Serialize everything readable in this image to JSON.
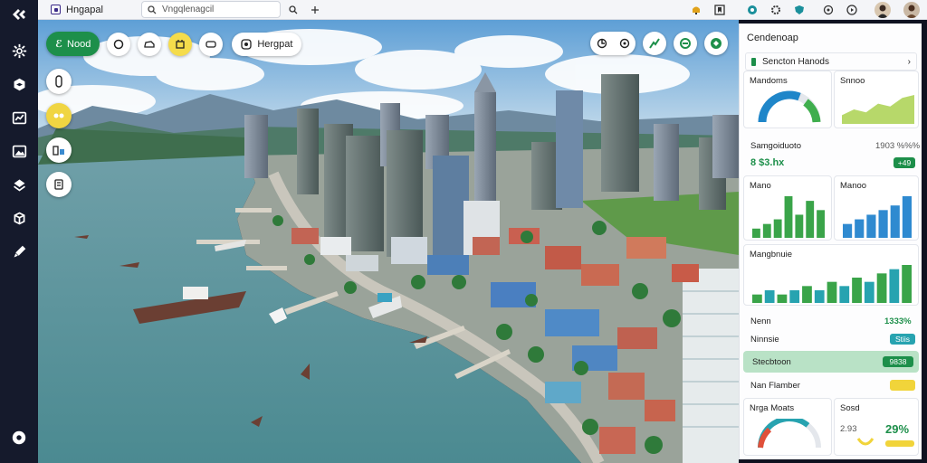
{
  "topbar": {
    "app_name": "Hngapal",
    "search_placeholder": "Vngqlenagcil",
    "icons": [
      "bell-icon",
      "bookmark-icon",
      "globe-icon",
      "settings-icon",
      "shield-icon",
      "gear-icon",
      "play-icon"
    ]
  },
  "viewport": {
    "primary_button": "Nood",
    "primary_button_icon": "ℰ",
    "location_label": "Hergpat",
    "tools": [
      "circle-tool",
      "car-tool",
      "build-tool",
      "vehicle-tool"
    ],
    "right_tools": [
      "view-toggle",
      "drone-tool",
      "nature-tool",
      "eco-tool"
    ]
  },
  "panel": {
    "title": "Cendenoap",
    "row1": {
      "label": "Sencton Hanods",
      "action": "›"
    },
    "card_gauge": {
      "title": "Mandoms",
      "value": 0.62,
      "color": "#1f86c9"
    },
    "card_area": {
      "title": "Snnoo",
      "values": [
        3,
        5,
        4,
        7,
        6,
        9,
        10
      ]
    },
    "stat": {
      "label": "Samgoiduoto",
      "value": "1903 %%%",
      "sub": "8 $3.hx",
      "tag": "+49"
    },
    "card_bars_green": {
      "title": "Mano",
      "values": [
        2,
        3,
        4,
        9,
        5,
        8,
        6
      ]
    },
    "card_bars_blue": {
      "title": "Manoo",
      "values": [
        3,
        4,
        5,
        6,
        7,
        9
      ]
    },
    "wide_bars": {
      "title": "Mangbnuie",
      "values": [
        2,
        3,
        2,
        3,
        4,
        3,
        5,
        4,
        6,
        5,
        7,
        8,
        9
      ]
    },
    "line_a": {
      "label": "Nenn",
      "value": "1333%"
    },
    "line_b": {
      "label": "Ninnsie",
      "tag": "Stiis"
    },
    "highlight": {
      "label": "Stecbtoon",
      "tag": "9838"
    },
    "line_c": {
      "label": "Nan Flamber",
      "tag": ""
    },
    "bottom_gauge": {
      "title": "Nrga Moats",
      "value": 0.72
    },
    "bottom_right": {
      "label": "Sosd",
      "value1": "2.93",
      "value2": "29%"
    }
  }
}
